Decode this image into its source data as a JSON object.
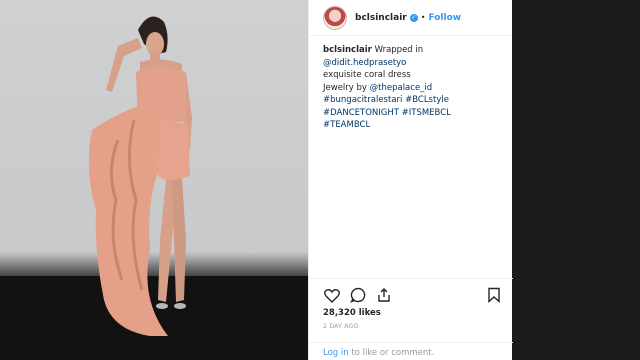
{
  "post": {
    "username": "bclsinclair",
    "separator": "•",
    "follow_label": "Follow",
    "verified_mark": "✓",
    "caption": {
      "author": "bclsinclair",
      "text_1": "Wrapped in",
      "mention_1": "@didit.hedprasetyo",
      "line_2": "exquisite coral dress",
      "line_3_prefix": "Jewelry by",
      "mention_2": "@thepalace_id",
      "hashtags_1": "#bungacitralestari #BCLstyle",
      "hashtags_2": "#DANCETONIGHT #ITSMEBCL #TEAMBCL"
    },
    "likes": "28,320 likes",
    "time_ago": "2 DAY AGO",
    "login_link": "Log in",
    "login_suffix": "to like or comment."
  },
  "icons": {
    "like": "heart-icon",
    "comment": "comment-icon",
    "share": "share-icon",
    "save": "bookmark-icon"
  },
  "colors": {
    "accent": "#3897f0",
    "dress": "#e8a48f",
    "wall": "#cfd0d2"
  }
}
